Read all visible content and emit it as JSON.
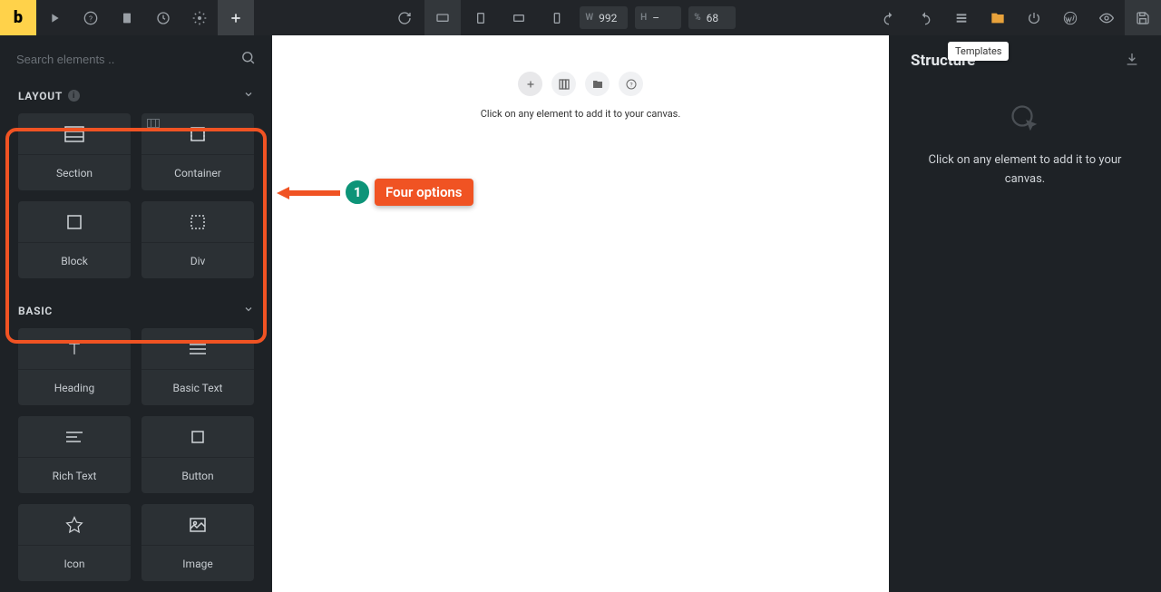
{
  "logo": "b",
  "toolbar": {
    "width_label": "W",
    "width_value": "992",
    "height_label": "H",
    "height_value": "–",
    "zoom_label": "%",
    "zoom_value": "68",
    "templates_tooltip": "Templates"
  },
  "left_panel": {
    "search_placeholder": "Search elements ..",
    "sections": [
      {
        "title": "LAYOUT",
        "has_info": true,
        "items": [
          {
            "label": "Section"
          },
          {
            "label": "Container"
          },
          {
            "label": "Block"
          },
          {
            "label": "Div"
          }
        ]
      },
      {
        "title": "BASIC",
        "has_info": false,
        "items": [
          {
            "label": "Heading"
          },
          {
            "label": "Basic Text"
          },
          {
            "label": "Rich Text"
          },
          {
            "label": "Button"
          },
          {
            "label": "Icon"
          },
          {
            "label": "Image"
          }
        ]
      }
    ]
  },
  "canvas": {
    "hint": "Click on any element to add it to your canvas."
  },
  "right_panel": {
    "title": "Structure",
    "empty_text": "Click on any element to add it to your canvas."
  },
  "annotation": {
    "number": "1",
    "label": "Four options"
  }
}
